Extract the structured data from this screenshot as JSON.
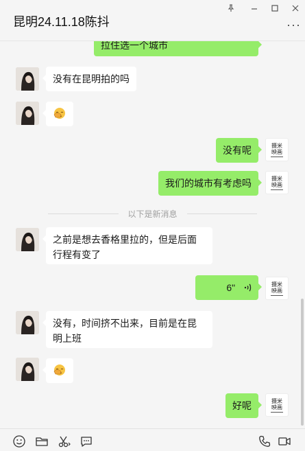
{
  "window": {
    "title": "昆明24.11.18陈抖",
    "controls": {
      "pin": "pin-icon",
      "minimize": "minimize-icon",
      "maximize": "maximize-icon",
      "close": "close-icon"
    },
    "more": "···"
  },
  "messages": [
    {
      "from": "me",
      "type": "text",
      "text": "拉住选一个城市"
    },
    {
      "from": "them",
      "type": "text",
      "text": "没有在昆明拍的吗"
    },
    {
      "from": "them",
      "type": "emoji",
      "emoji": "facepalm-emoji"
    },
    {
      "from": "me",
      "type": "text",
      "text": "没有呢"
    },
    {
      "from": "me",
      "type": "text",
      "text": "我们的城市有考虑吗"
    },
    {
      "from": "them",
      "type": "text",
      "text": "之前是想去香格里拉的，但是后面行程有变了"
    },
    {
      "from": "me",
      "type": "voice",
      "duration": "6\""
    },
    {
      "from": "them",
      "type": "text",
      "text": "没有，时间挤不出来，目前是在昆明上班"
    },
    {
      "from": "them",
      "type": "emoji",
      "emoji": "facepalm-emoji"
    },
    {
      "from": "me",
      "type": "text",
      "text": "好呢"
    }
  ],
  "divider_text": "以下是新消息",
  "my_avatar": {
    "line1": "摄米",
    "line2": "映画"
  },
  "toolbar": {
    "left": [
      "emoji-icon",
      "folder-icon",
      "scissors-icon",
      "chat-bubble-icon"
    ],
    "right": [
      "phone-icon",
      "video-call-icon"
    ]
  },
  "colors": {
    "outgoing_bubble": "#95ec69",
    "incoming_bubble": "#ffffff",
    "background": "#f5f5f5"
  }
}
